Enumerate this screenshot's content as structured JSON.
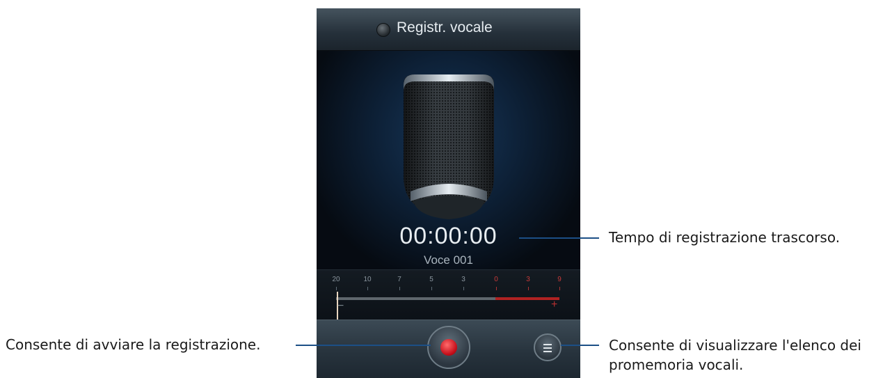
{
  "app": {
    "title": "Registr. vocale"
  },
  "recorder": {
    "elapsed_time": "00:00:00",
    "memo_name": "Voce 001"
  },
  "level_meter": {
    "labels": [
      "20",
      "10",
      "7",
      "5",
      "3",
      "0",
      "3",
      "9"
    ],
    "minus": "−",
    "plus": "+"
  },
  "callouts": {
    "elapsed": "Tempo di registrazione trascorso.",
    "record": "Consente di avviare la registrazione.",
    "list_line1": "Consente di visualizzare l'elenco dei",
    "list_line2": "promemoria vocali."
  },
  "icons": {
    "record": "record-icon",
    "list": "list-icon",
    "microphone": "microphone-icon",
    "status": "record-status-icon"
  },
  "colors": {
    "record_red": "#c40e1a",
    "callout_line": "#1c4f86",
    "meter_red": "#b02222"
  }
}
